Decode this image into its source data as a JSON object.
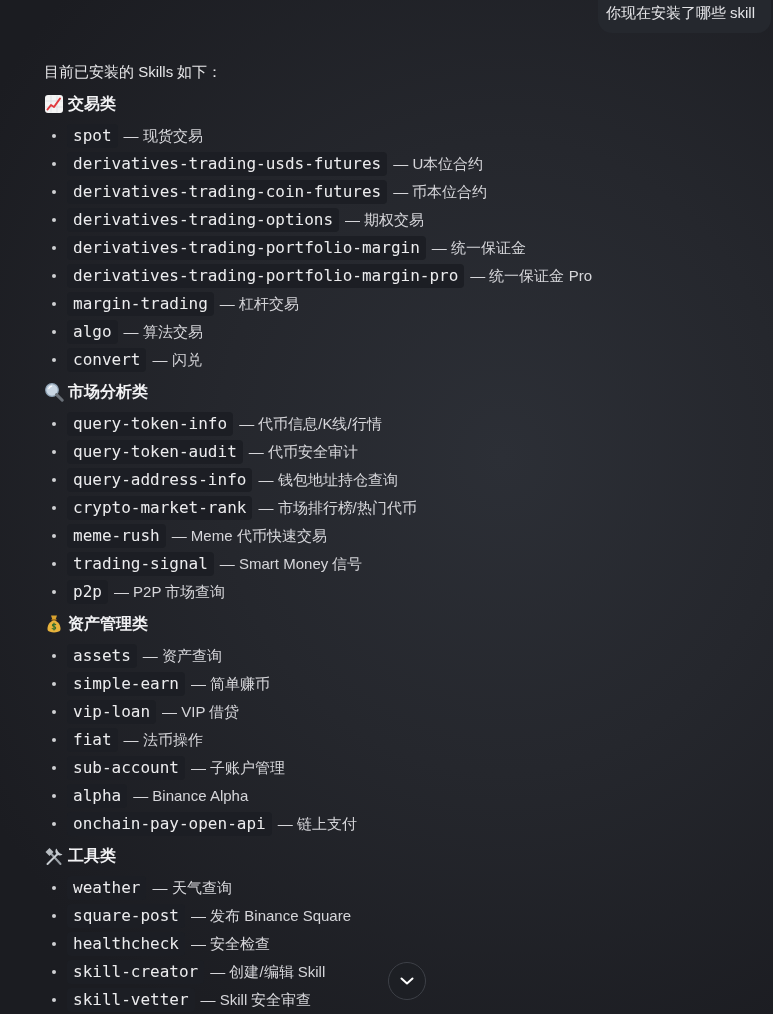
{
  "user_message": {
    "text": "你现在安装了哪些 skill"
  },
  "reply": {
    "intro": "目前已安装的 Skills 如下：",
    "sections": [
      {
        "kind": "chart",
        "title": "交易类",
        "items": [
          {
            "code": "spot",
            "description": "— 现货交易"
          },
          {
            "code": "derivatives-trading-usds-futures",
            "description": "— U本位合约"
          },
          {
            "code": "derivatives-trading-coin-futures",
            "description": "— 币本位合约"
          },
          {
            "code": "derivatives-trading-options",
            "description": "— 期权交易"
          },
          {
            "code": "derivatives-trading-portfolio-margin",
            "description": "— 统一保证金"
          },
          {
            "code": "derivatives-trading-portfolio-margin-pro",
            "description": "— 统一保证金 Pro"
          },
          {
            "code": "margin-trading",
            "description": "— 杠杆交易"
          },
          {
            "code": "algo",
            "description": "— 算法交易"
          },
          {
            "code": "convert",
            "description": "— 闪兑"
          }
        ]
      },
      {
        "kind": "magnifier",
        "title": "市场分析类",
        "items": [
          {
            "code": "query-token-info",
            "description": "— 代币信息/K线/行情"
          },
          {
            "code": "query-token-audit",
            "description": "— 代币安全审计"
          },
          {
            "code": "query-address-info",
            "description": "— 钱包地址持仓查询"
          },
          {
            "code": "crypto-market-rank",
            "description": "— 市场排行榜/热门代币"
          },
          {
            "code": "meme-rush",
            "description": "— Meme 代币快速交易"
          },
          {
            "code": "trading-signal",
            "description": "— Smart Money 信号"
          },
          {
            "code": "p2p",
            "description": "— P2P 市场查询"
          }
        ]
      },
      {
        "kind": "moneybag",
        "title": "资产管理类",
        "items": [
          {
            "code": "assets",
            "description": "— 资产查询"
          },
          {
            "code": "simple-earn",
            "description": "— 简单赚币"
          },
          {
            "code": "vip-loan",
            "description": "— VIP 借贷"
          },
          {
            "code": "fiat",
            "description": "— 法币操作"
          },
          {
            "code": "sub-account",
            "description": "— 子账户管理"
          },
          {
            "code": "alpha",
            "description": "— Binance Alpha"
          },
          {
            "code": "onchain-pay-open-api",
            "description": "— 链上支付"
          }
        ]
      },
      {
        "kind": "tools",
        "title": "工具类",
        "items": [
          {
            "code": "weather",
            "description": "— 天气查询"
          },
          {
            "code": "square-post",
            "description": "— 发布 Binance Square"
          },
          {
            "code": "healthcheck",
            "description": "— 安全检查"
          },
          {
            "code": "skill-creator",
            "description": "— 创建/编辑 Skill"
          },
          {
            "code": "skill-vetter",
            "description": "— Skill 安全审查"
          }
        ]
      }
    ]
  }
}
